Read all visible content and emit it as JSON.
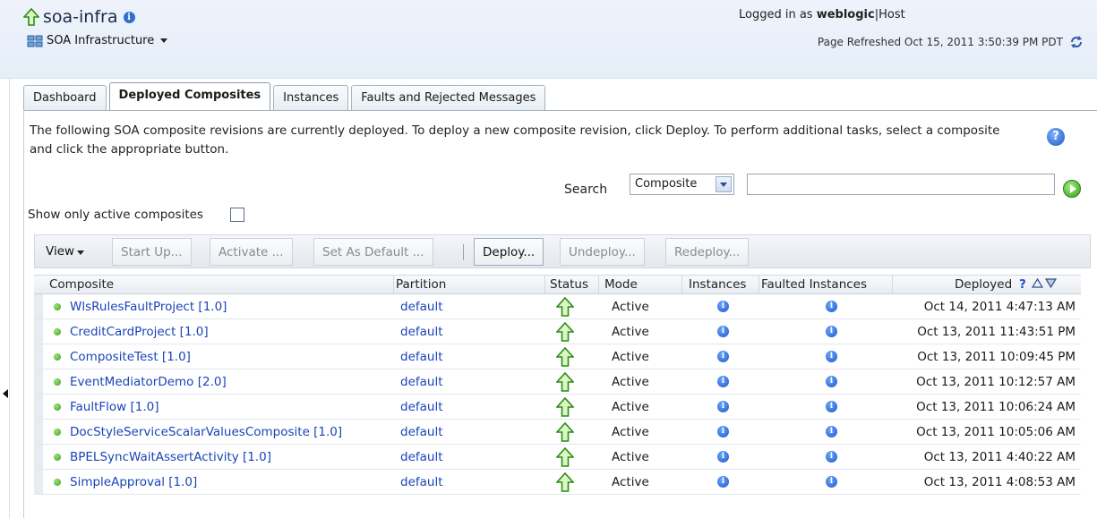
{
  "header": {
    "title": "soa-infra",
    "subnav_label": "SOA Infrastructure",
    "logged_in_prefix": "Logged in as",
    "user": "weblogic",
    "host_sep": "|",
    "host_label": "Host",
    "refreshed": "Page Refreshed Oct 15, 2011 3:50:39 PM PDT"
  },
  "tabs": [
    {
      "label": "Dashboard",
      "active": false
    },
    {
      "label": "Deployed Composites",
      "active": true
    },
    {
      "label": "Instances",
      "active": false
    },
    {
      "label": "Faults and Rejected Messages",
      "active": false
    }
  ],
  "description": "The following SOA composite revisions are currently deployed. To deploy a new composite revision, click Deploy. To perform additional tasks, select a composite and click the appropriate button.",
  "search": {
    "label": "Search",
    "type_value": "Composite",
    "query": ""
  },
  "filter": {
    "active_only_label": "Show only active composites",
    "active_only_checked": false
  },
  "toolbar": {
    "view_label": "View",
    "start_up": "Start Up...",
    "activate": "Activate ...",
    "set_default": "Set As Default ...",
    "deploy": "Deploy...",
    "undeploy": "Undeploy...",
    "redeploy": "Redeploy..."
  },
  "table": {
    "columns": {
      "composite": "Composite",
      "partition": "Partition",
      "status": "Status",
      "mode": "Mode",
      "instances": "Instances",
      "faulted": "Faulted Instances",
      "deployed": "Deployed"
    },
    "rows": [
      {
        "composite": "WlsRulesFaultProject [1.0]",
        "partition": "default",
        "mode": "Active",
        "deployed": "Oct 14, 2011 4:47:13 AM"
      },
      {
        "composite": "CreditCardProject [1.0]",
        "partition": "default",
        "mode": "Active",
        "deployed": "Oct 13, 2011 11:43:51 PM"
      },
      {
        "composite": "CompositeTest [1.0]",
        "partition": "default",
        "mode": "Active",
        "deployed": "Oct 13, 2011 10:09:45 PM"
      },
      {
        "composite": "EventMediatorDemo [2.0]",
        "partition": "default",
        "mode": "Active",
        "deployed": "Oct 13, 2011 10:12:57 AM"
      },
      {
        "composite": "FaultFlow [1.0]",
        "partition": "default",
        "mode": "Active",
        "deployed": "Oct 13, 2011 10:06:24 AM"
      },
      {
        "composite": "DocStyleServiceScalarValuesComposite [1.0]",
        "partition": "default",
        "mode": "Active",
        "deployed": "Oct 13, 2011 10:05:06 AM"
      },
      {
        "composite": "BPELSyncWaitAssertActivity [1.0]",
        "partition": "default",
        "mode": "Active",
        "deployed": "Oct 13, 2011 4:40:22 AM"
      },
      {
        "composite": "SimpleApproval [1.0]",
        "partition": "default",
        "mode": "Active",
        "deployed": "Oct 13, 2011 4:08:53 AM"
      }
    ]
  },
  "icons": {
    "up": "up-arrow-icon",
    "info": "info-icon",
    "help": "help-icon",
    "refresh": "refresh-icon",
    "go": "go-icon"
  }
}
